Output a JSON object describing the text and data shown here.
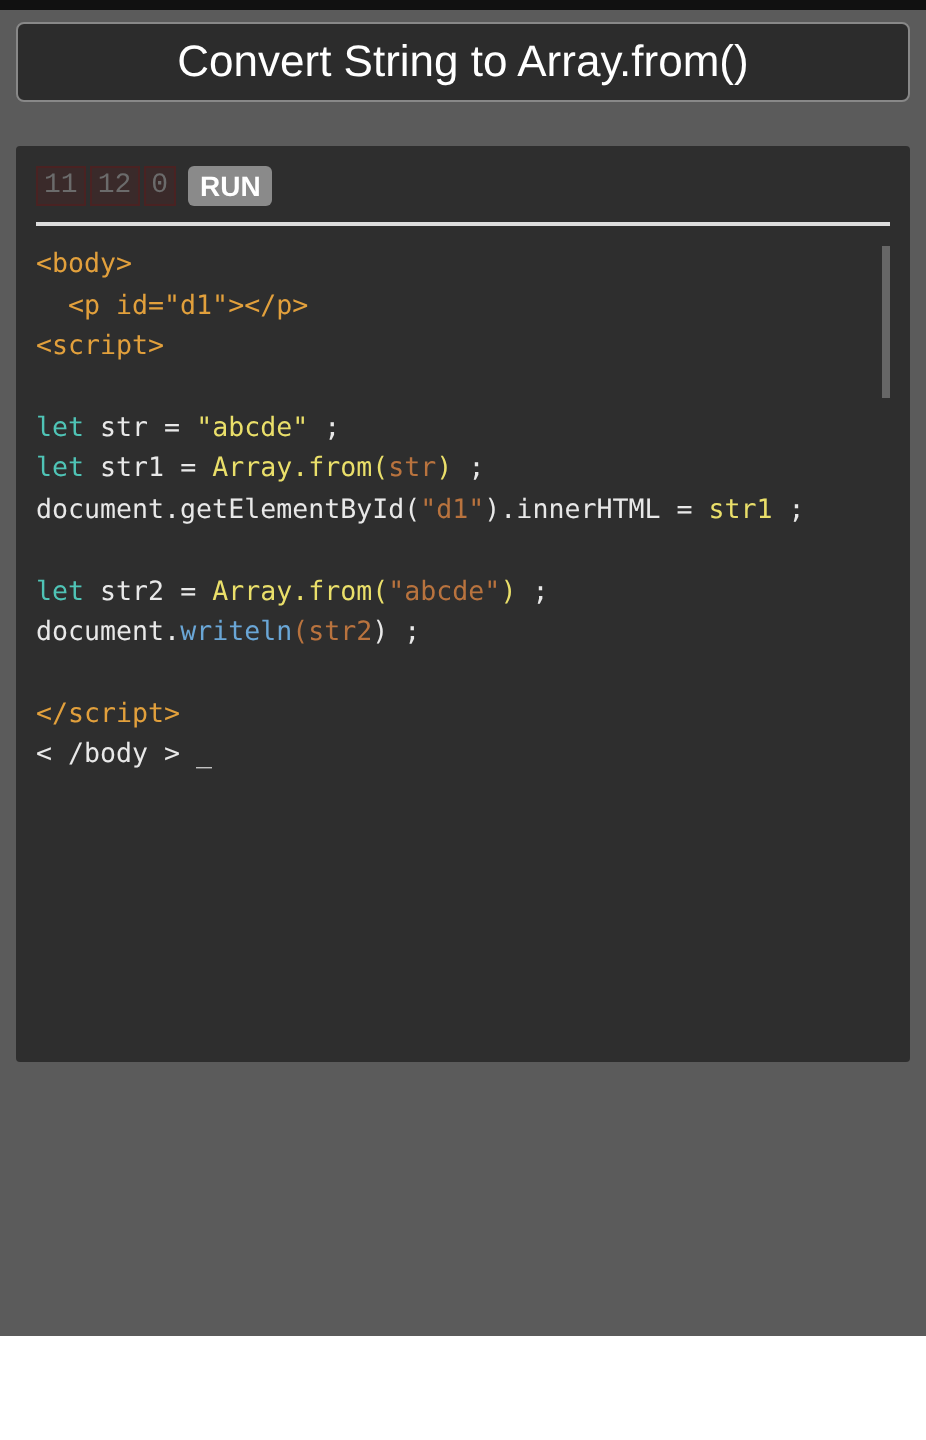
{
  "title": "Convert String to Array.from()",
  "toolbar": {
    "counters": [
      "11",
      "12",
      "0"
    ],
    "run_label": "RUN"
  },
  "code_blocks": [
    [
      [
        {
          "kind": "tag",
          "text": "<body>"
        }
      ],
      [
        {
          "kind": "tag",
          "text": "  <p id=\"d1\"></p>"
        }
      ],
      [
        {
          "kind": "tag",
          "text": "<script>"
        }
      ]
    ],
    [
      [
        {
          "kind": "keyword",
          "text": "let"
        },
        {
          "kind": "plain",
          "text": " str = "
        },
        {
          "kind": "literal",
          "text": "\"abcde\""
        },
        {
          "kind": "plain",
          "text": " ;"
        }
      ],
      [
        {
          "kind": "keyword",
          "text": "let"
        },
        {
          "kind": "plain",
          "text": " str1 = "
        },
        {
          "kind": "literal",
          "text": "Array.from("
        },
        {
          "kind": "arg",
          "text": "str"
        },
        {
          "kind": "literal",
          "text": ")"
        },
        {
          "kind": "plain",
          "text": " ;"
        }
      ],
      [
        {
          "kind": "plain",
          "text": "document.getElementById("
        },
        {
          "kind": "arg",
          "text": "\"d1\""
        },
        {
          "kind": "plain",
          "text": ").innerHTML = "
        },
        {
          "kind": "literal",
          "text": "str1"
        },
        {
          "kind": "plain",
          "text": " ;"
        }
      ]
    ],
    [
      [
        {
          "kind": "keyword",
          "text": "let"
        },
        {
          "kind": "plain",
          "text": " str2 = "
        },
        {
          "kind": "literal",
          "text": "Array.from("
        },
        {
          "kind": "arg",
          "text": "\"abcde\""
        },
        {
          "kind": "literal",
          "text": ")"
        },
        {
          "kind": "plain",
          "text": " ;"
        }
      ],
      [
        {
          "kind": "plain",
          "text": "document."
        },
        {
          "kind": "method",
          "text": "writeln"
        },
        {
          "kind": "arg",
          "text": "(str2"
        },
        {
          "kind": "plain",
          "text": ") ;"
        }
      ]
    ],
    [
      [
        {
          "kind": "tag",
          "text": "</script>"
        }
      ],
      [
        {
          "kind": "plain",
          "text": "< /body > _"
        }
      ]
    ]
  ]
}
